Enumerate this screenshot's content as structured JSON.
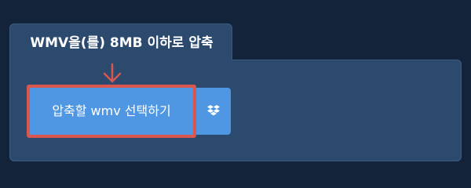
{
  "panel": {
    "title": "WMV을(를) 8MB 이하로 압축"
  },
  "upload": {
    "select_label": "압축할 wmv 선택하기",
    "dropbox_icon": "dropbox-icon"
  },
  "colors": {
    "background": "#12233a",
    "panel": "#2c4a6e",
    "button": "#4f97e2",
    "highlight": "#d9574f"
  }
}
